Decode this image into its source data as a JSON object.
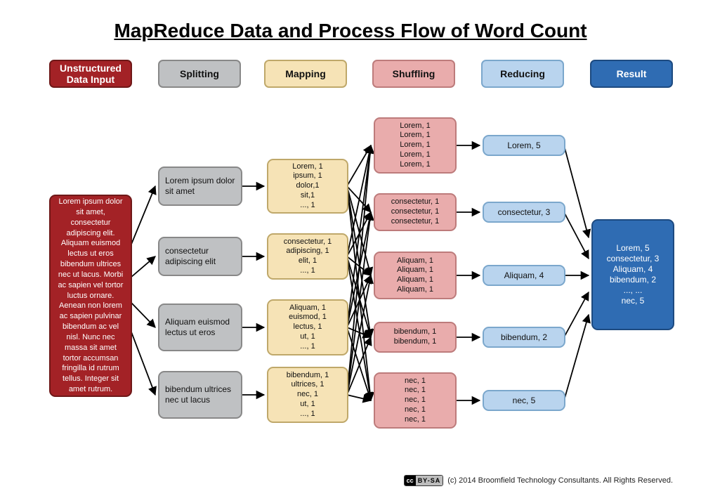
{
  "title": "MapReduce Data and Process Flow of Word Count",
  "headers": {
    "input": "Unstructured Data Input",
    "splitting": "Splitting",
    "mapping": "Mapping",
    "shuffling": "Shuffling",
    "reducing": "Reducing",
    "result": "Result"
  },
  "input_text": "Lorem ipsum dolor sit amet, consectetur adipiscing elit. Aliquam euismod lectus ut eros bibendum ultrices nec ut lacus. Morbi ac sapien vel tortor luctus ornare. Aenean non lorem ac sapien pulvinar bibendum ac vel nisl. Nunc nec massa sit amet tortor accumsan fringilla id rutrum tellus. Integer sit amet rutrum.",
  "splitting": [
    "Lorem ipsum dolor sit amet",
    "consectetur adipiscing elit",
    "Aliquam euismod lectus ut eros",
    "bibendum ultrices nec ut lacus"
  ],
  "mapping": [
    "Lorem, 1\nipsum, 1\ndolor,1\nsit,1\n..., 1",
    "consectetur, 1\nadipiscing, 1\nelit, 1\n..., 1",
    "Aliquam, 1\neuismod, 1\nlectus, 1\nut, 1\n..., 1",
    "bibendum, 1\nultrices, 1\nnec, 1\nut, 1\n..., 1"
  ],
  "shuffling": [
    "Lorem, 1\nLorem, 1\nLorem, 1\nLorem, 1\nLorem, 1",
    "consectetur, 1\nconsectetur, 1\nconsectetur, 1",
    "Aliquam, 1\nAliquam, 1\nAliquam, 1\nAliquam, 1",
    "bibendum, 1\nbibendum, 1",
    "nec, 1\nnec, 1\nnec, 1\nnec, 1\nnec, 1"
  ],
  "reducing": [
    "Lorem, 5",
    "consectetur, 3",
    "Aliquam, 4",
    "bibendum, 2",
    "nec, 5"
  ],
  "result": "Lorem, 5\nconsectetur, 3\nAliquam, 4\nbibendum, 2\n..., ...\nnec, 5",
  "footer": {
    "license_left": "cc",
    "license_right": "BY-SA",
    "copyright": "(c) 2014 Broomfield Technology Consultants. All Rights Reserved."
  },
  "chart_data": {
    "type": "diagram",
    "title": "MapReduce Data and Process Flow of Word Count",
    "stages": [
      "Unstructured Data Input",
      "Splitting",
      "Mapping",
      "Shuffling",
      "Reducing",
      "Result"
    ],
    "nodes": {
      "input": [
        "input0"
      ],
      "splitting": [
        "split0",
        "split1",
        "split2",
        "split3"
      ],
      "mapping": [
        "map0",
        "map1",
        "map2",
        "map3"
      ],
      "shuffling": [
        "shuf0",
        "shuf1",
        "shuf2",
        "shuf3",
        "shuf4"
      ],
      "reducing": [
        "red0",
        "red1",
        "red2",
        "red3",
        "red4"
      ],
      "result": [
        "res0"
      ]
    },
    "edges": [
      [
        "input0",
        "split0"
      ],
      [
        "input0",
        "split1"
      ],
      [
        "input0",
        "split2"
      ],
      [
        "input0",
        "split3"
      ],
      [
        "split0",
        "map0"
      ],
      [
        "split1",
        "map1"
      ],
      [
        "split2",
        "map2"
      ],
      [
        "split3",
        "map3"
      ],
      [
        "map0",
        "shuf0"
      ],
      [
        "map0",
        "shuf1"
      ],
      [
        "map0",
        "shuf2"
      ],
      [
        "map0",
        "shuf3"
      ],
      [
        "map0",
        "shuf4"
      ],
      [
        "map1",
        "shuf0"
      ],
      [
        "map1",
        "shuf1"
      ],
      [
        "map1",
        "shuf2"
      ],
      [
        "map1",
        "shuf3"
      ],
      [
        "map1",
        "shuf4"
      ],
      [
        "map2",
        "shuf0"
      ],
      [
        "map2",
        "shuf1"
      ],
      [
        "map2",
        "shuf2"
      ],
      [
        "map2",
        "shuf3"
      ],
      [
        "map2",
        "shuf4"
      ],
      [
        "map3",
        "shuf0"
      ],
      [
        "map3",
        "shuf1"
      ],
      [
        "map3",
        "shuf2"
      ],
      [
        "map3",
        "shuf3"
      ],
      [
        "map3",
        "shuf4"
      ],
      [
        "shuf0",
        "red0"
      ],
      [
        "shuf1",
        "red1"
      ],
      [
        "shuf2",
        "red2"
      ],
      [
        "shuf3",
        "red3"
      ],
      [
        "shuf4",
        "red4"
      ],
      [
        "red0",
        "res0"
      ],
      [
        "red1",
        "res0"
      ],
      [
        "red2",
        "res0"
      ],
      [
        "red3",
        "res0"
      ],
      [
        "red4",
        "res0"
      ]
    ]
  }
}
